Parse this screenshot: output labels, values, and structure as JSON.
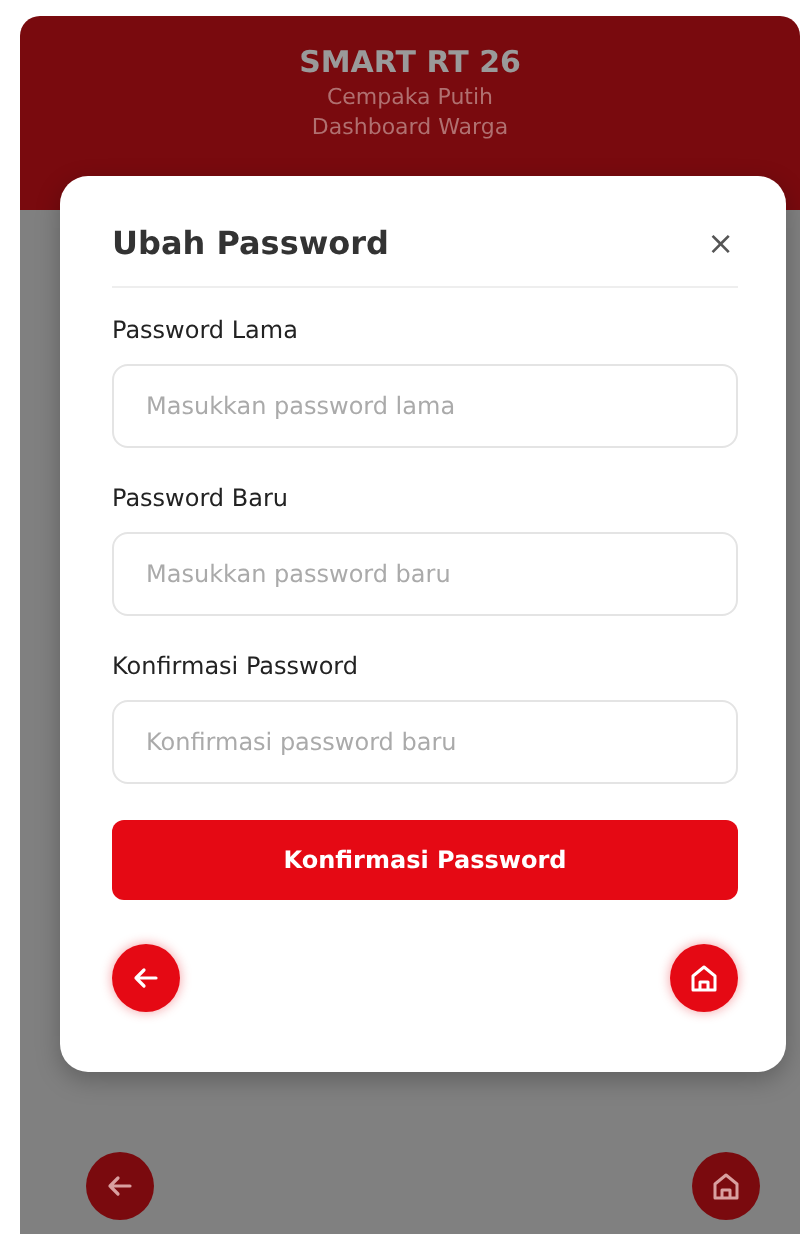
{
  "header": {
    "title": "SMART RT 26",
    "lines": [
      "Cempaka Putih",
      "Dashboard Warga"
    ]
  },
  "modal": {
    "title": "Ubah Password",
    "close": "×",
    "fields": [
      {
        "label": "Password Lama",
        "placeholder": "Masukkan password lama"
      },
      {
        "label": "Password Baru",
        "placeholder": "Masukkan password baru"
      },
      {
        "label": "Konfirmasi Password",
        "placeholder": "Konfirmasi password baru"
      }
    ],
    "submit": "Konfirmasi Password"
  }
}
